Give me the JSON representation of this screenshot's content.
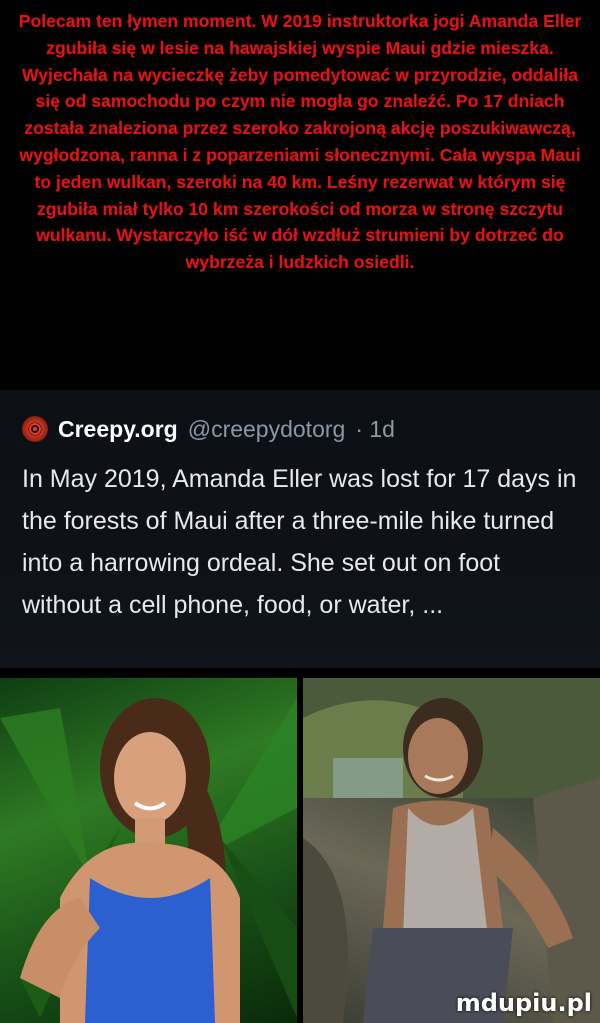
{
  "caption": {
    "text": "Polecam ten łymen moment. W 2019 instruktorka jogi Amanda Eller zgubiła się w lesie na hawajskiej wyspie Maui gdzie mieszka. Wyjechała na wycieczkę żeby pomedytować w przyrodzie, oddaliła się od samochodu po czym nie mogła go znaleźć. Po 17 dniach została znaleziona przez szeroko zakrojoną akcję poszukiwawczą, wygłodzona, ranna i z poparzeniami słonecznymi. Cała wyspa Maui to jeden wulkan, szeroki na 40 km. Leśny rezerwat w którym się zgubiła miał tylko 10 km szerokości od morza w stronę szczytu wulkanu. Wystarczyło iść w dół wzdłuż strumieni by dotrzeć do wybrzeża i ludzkich osiedli.",
    "color": "#e01414"
  },
  "tweet": {
    "account_name": "Creepy.org",
    "handle": "@creepydotorg",
    "time": "· 1d",
    "body": "In May 2019, Amanda Eller was lost for 17 days in the forests of Maui after a three-mile hike turned into a harrowing ordeal. She set out on foot without a cell phone, food, or water, ..."
  },
  "photos": {
    "watermark": "mdupiu.pl"
  }
}
